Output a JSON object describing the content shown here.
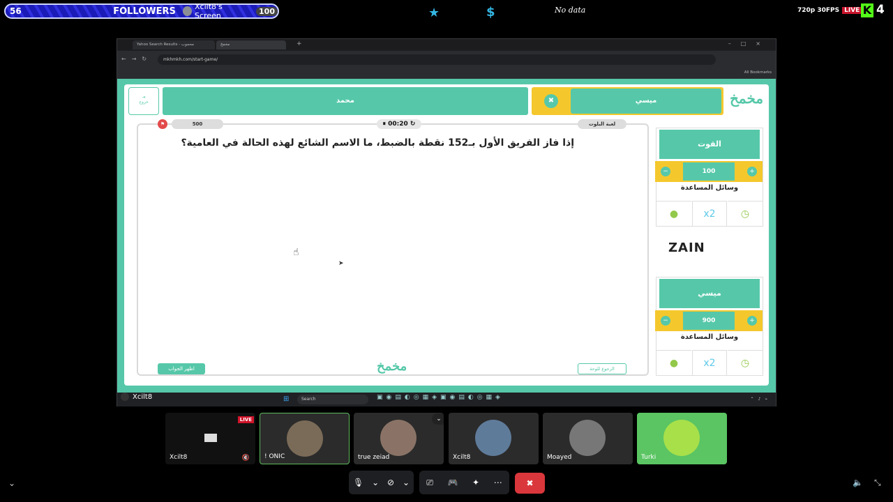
{
  "overlay": {
    "followers_count": "56",
    "followers_label": "FOLLOWERS",
    "screen_label": "Xcilt8's Screen",
    "goal": "100",
    "no_data": "No data",
    "stream_quality": "720p 30FPS",
    "live": "LIVE",
    "kick_count": "4"
  },
  "browser": {
    "tab1_title": "Yahoo Search Results - محجوب",
    "tab2_title": "مخمخ",
    "url": "mkhmkh.com/start-game/",
    "bookmarks": "All Bookmarks"
  },
  "game": {
    "exit_label": "خروج",
    "team_left": "محمد",
    "team_right": "ميسي",
    "points": "500",
    "timer": "00:20",
    "category": "لعبة البلوت",
    "question": "إذا فاز الفريق الأول بـ152 نقطة بالضبط، ما الاسم الشائع لهذه الحالة في العامية؟",
    "show_answer": "اظهر الجواب",
    "back_to_board": "الرجوع للوحة",
    "logo": "مخمخ",
    "aids_label": "وسائل المساعدة",
    "sponsor": "ZAIN",
    "side_teams": [
      {
        "name": "القوت",
        "score": "100"
      },
      {
        "name": "ميسي",
        "score": "900"
      }
    ]
  },
  "taskbar": {
    "search": "Search"
  },
  "streamer": {
    "name": "Xcilt8"
  },
  "participants": [
    {
      "name": "Xcilt8",
      "live": "LIVE"
    },
    {
      "name": "! ONIC"
    },
    {
      "name": "true zeiad"
    },
    {
      "name": "Xcilt8"
    },
    {
      "name": "Moayed"
    },
    {
      "name": "Turki"
    }
  ],
  "colors": {
    "teal": "#56c8a9",
    "yellow": "#f4c82d",
    "danger": "#da373c"
  }
}
